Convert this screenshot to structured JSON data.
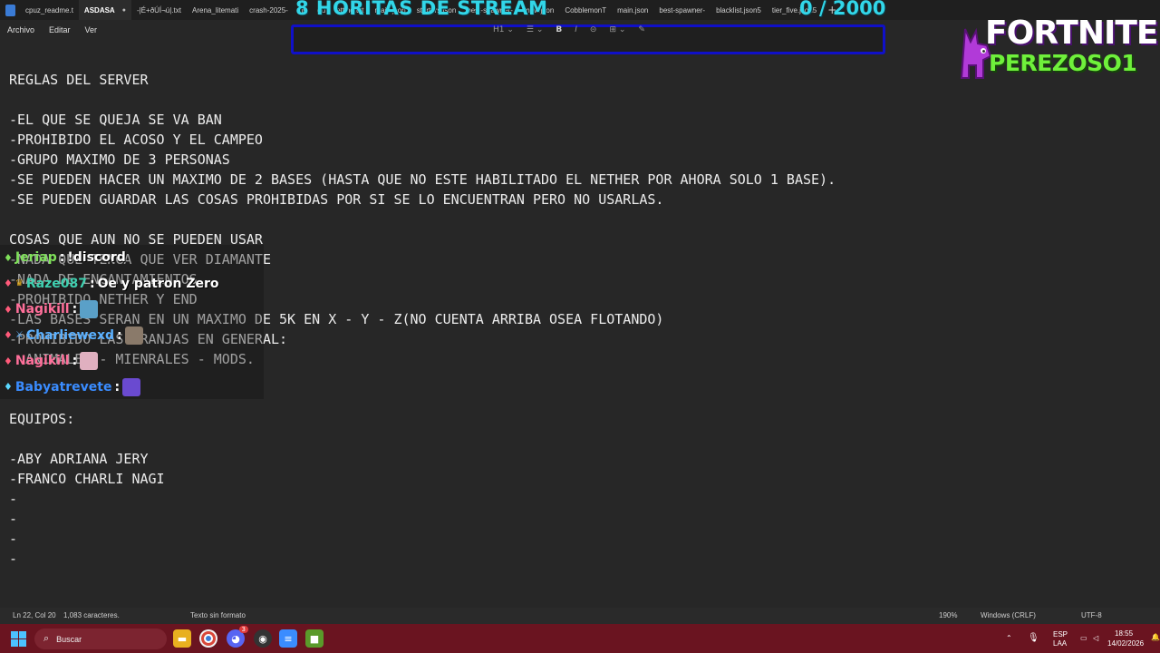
{
  "tabs": [
    {
      "label": "cpuz_readme.t",
      "active": false
    },
    {
      "label": "ASDASA",
      "active": true
    },
    {
      "label": "-|É+ðÚÍ¬ú|.txt",
      "active": false
    },
    {
      "label": "Arena_litemati",
      "active": false
    },
    {
      "label": "crash-2025-",
      "active": false
    },
    {
      "label": "ns",
      "active": false
    },
    {
      "label": "qu",
      "active": false
    },
    {
      "label": "etting.txt",
      "active": false
    },
    {
      "label": "main.json",
      "active": false
    },
    {
      "label": "starters.json",
      "active": false
    },
    {
      "label": "best-spawner-",
      "active": false
    },
    {
      "label": "mew.json",
      "active": false
    },
    {
      "label": "CobblemonT",
      "active": false
    },
    {
      "label": "main.json",
      "active": false
    },
    {
      "label": "best-spawner-",
      "active": false
    },
    {
      "label": "blacklist.json5",
      "active": false
    },
    {
      "label": "tier_five.json5",
      "active": false
    }
  ],
  "new_tab": "+",
  "menu": [
    "Archivo",
    "Editar",
    "Ver"
  ],
  "format_toolbar": [
    "H1 ⌄",
    "☰ ⌄",
    "B",
    "I",
    "⊝",
    "⊞ ⌄",
    "✎"
  ],
  "overlay": {
    "stream_title": "8 HORITAS DE STREAM",
    "goal_counter": "0 / 2000",
    "goal_current": 0,
    "goal_target": 2000,
    "goal_color": "#32d6e8"
  },
  "logo": {
    "title": "FORTNITE",
    "subtitle": "PEREZOSO1"
  },
  "document_lines": [
    "REGLAS DEL SERVER",
    "",
    "-EL QUE SE QUEJA SE VA BAN",
    "-PROHIBIDO EL ACOSO Y EL CAMPEO",
    "-GRUPO MAXIMO DE 3 PERSONAS",
    "-SE PUEDEN HACER UN MAXIMO DE 2 BASES (HASTA QUE NO ESTE HABILITADO EL NETHER POR AHORA SOLO 1 BASE).",
    "-SE PUEDEN GUARDAR LAS COSAS PROHIBIDAS POR SI SE LO ENCUENTRAN PERO NO USARLAS.",
    "",
    "COSAS QUE AUN NO SE PUEDEN USAR",
    "-NADA QUE TENGA QUE VER DIAMANTE",
    "-NADA DE ENCANTAMIENTOS",
    "-PROHIBIDO NETHER Y END",
    "-LAS BASES SERAN EN UN MAXIMO DE 5K EN X - Y - Z(NO CUENTA ARRIBA OSEA FLOTANDO)",
    "-PROHIBIDO LAS GRANJAS EN GENERAL:",
    "  ANIMALES - MIENRALES - MODS.",
    "",
    "",
    "EQUIPOS:",
    "",
    "-ABY ADRIANA JERY",
    "-FRANCO CHARLI NAGI",
    "-",
    "-",
    "-",
    "-"
  ],
  "chat": [
    {
      "user": "Jeriap",
      "user_color": "#7fe05a",
      "text": "!discord",
      "emote": null,
      "badge": "♦",
      "badge_color": "#7fe05a",
      "badge2": null
    },
    {
      "user": "Raze087",
      "user_color": "#3fd0b0",
      "text": "Oe y patron Zero",
      "emote": null,
      "badge": "♦",
      "badge_color": "#ff5a7a",
      "badge2": "♛",
      "badge2_color": "#e8b020"
    },
    {
      "user": "Nagikill",
      "user_color": "#ff6f9a",
      "text": "",
      "emote": "#5aa0c8",
      "badge": "♦",
      "badge_color": "#ff5a7a",
      "badge2": null
    },
    {
      "user": "Charliewexd",
      "user_color": "#5ab0ff",
      "text": "",
      "emote": "#8a7a6a",
      "badge": "♦",
      "badge_color": "#ff5a7a",
      "badge2": "⚔",
      "badge2_color": "#5ab0ff"
    },
    {
      "user": "Nagikill",
      "user_color": "#ff6f9a",
      "text": "",
      "emote": "#e0b0c0",
      "badge": "♦",
      "badge_color": "#ff5a7a",
      "badge2": null
    },
    {
      "user": "Babyatrevete",
      "user_color": "#3a8cff",
      "text": "",
      "emote": "#6a4ad0",
      "badge": "♦",
      "badge_color": "#5ad8ff",
      "badge2": null
    }
  ],
  "status": {
    "position": "Ln 22, Col 20",
    "chars": "1,083 caracteres.",
    "format": "Texto sin formato",
    "zoom": "190%",
    "eol": "Windows (CRLF)",
    "encoding": "UTF-8"
  },
  "taskbar": {
    "search_placeholder": "Buscar",
    "lang_top": "ESP",
    "lang_bottom": "LAA",
    "time": "18:55",
    "date": "14/02/2026",
    "discord_badge": "3"
  }
}
